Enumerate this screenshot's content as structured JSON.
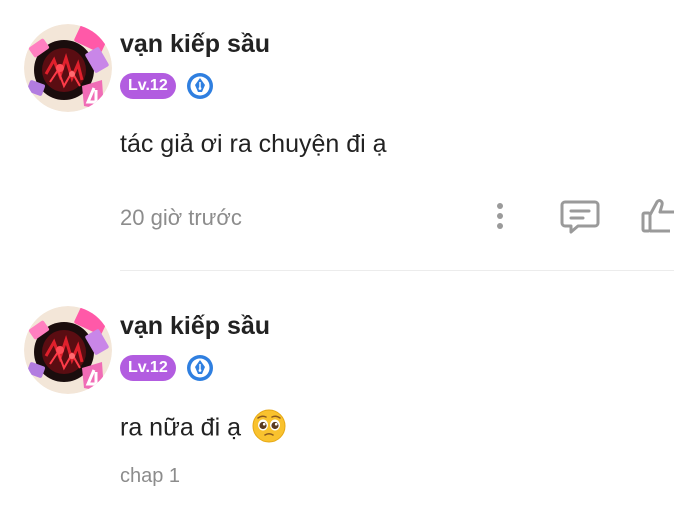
{
  "comments": [
    {
      "username": "vạn kiếp sầu",
      "level": "Lv.12",
      "text": "tác giả ơi ra chuyện đi ạ",
      "timestamp": "20 giờ trước",
      "icons": [
        "more-vertical-icon",
        "reply-icon",
        "thumbs-up-icon"
      ]
    },
    {
      "username": "vạn kiếp sầu",
      "level": "Lv.12",
      "text": "ra nữa đi ạ",
      "emoji": "pleading-face-emoji",
      "chapter": "chap 1"
    }
  ],
  "colors": {
    "level_badge": "#b25ce0",
    "pen_badge": "#2f7fe0",
    "meta_text": "#8c8c8c",
    "icon_gray": "#9a9a9a"
  }
}
